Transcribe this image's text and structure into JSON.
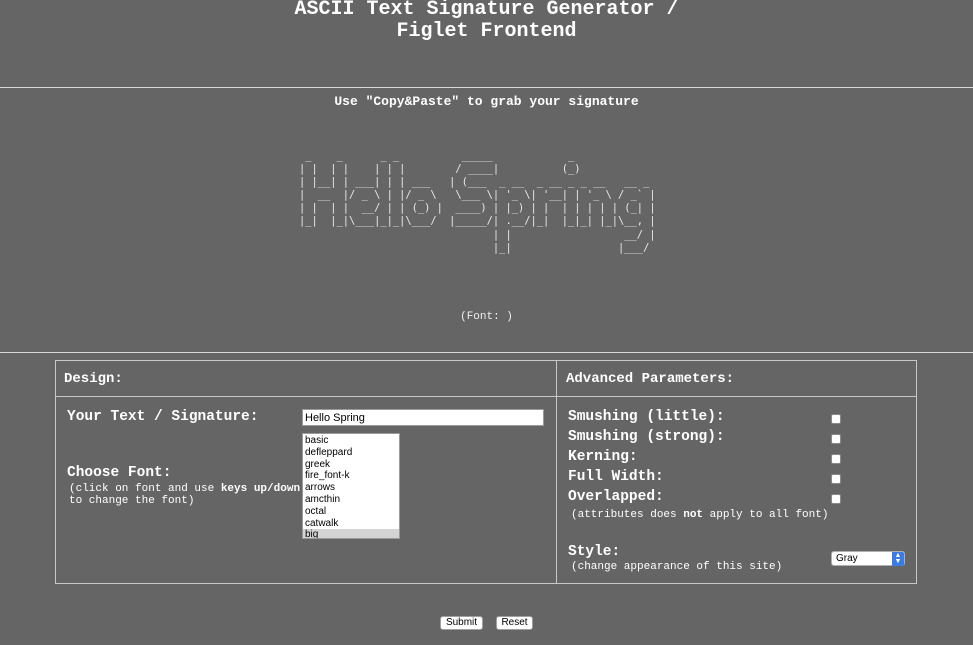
{
  "title_line1": "ASCII Text Signature Generator /",
  "title_line2": "Figlet Frontend",
  "copy_note": "Use \"Copy&Paste\" to grab your signature",
  "ascii_art": " _    _      _ _          _____            _             \n| |  | |    | | |        / ____|          (_)            \n| |__| | ___| | | ___   | (___  _ __  _ __ _ _ __   __ _ \n|  __  |/ _ \\ | |/ _ \\   \\___ \\| '_ \\| '__| | '_ \\ / _` |\n| |  | |  __/ | | (_) |  ____) | |_) | |  | | | | | (_| |\n|_|  |_|\\___|_|_|\\___/  |_____/| .__/|_|  |_|_| |_|\\__, |\n                               | |                  __/ |\n                               |_|                 |___/ ",
  "font_note": "(Font: )",
  "design": {
    "header": "Design:",
    "text_label": "Your Text / Signature:",
    "text_value": "Hello Spring",
    "font_label": "Choose Font:",
    "font_hint_pre": "(click on font and use ",
    "font_hint_bold": "keys up/down",
    "font_hint_post": "to change the font)",
    "fonts": [
      "basic",
      "defleppard",
      "greek",
      "fire_font-k",
      "arrows",
      "amcthin",
      "octal",
      "catwalk",
      "big"
    ],
    "selected_font": "big"
  },
  "advanced": {
    "header": "Advanced Parameters:",
    "options": [
      {
        "label": "Smushing (little):",
        "checked": false
      },
      {
        "label": "Smushing (strong):",
        "checked": false
      },
      {
        "label": "Kerning:",
        "checked": false
      },
      {
        "label": "Full Width:",
        "checked": false
      },
      {
        "label": "Overlapped:",
        "checked": false
      }
    ],
    "note_pre": "(attributes does ",
    "note_bold": "not",
    "note_post": " apply to all font)",
    "style_label": "Style:",
    "style_hint": "(change appearance of this site)",
    "style_value": "Gray"
  },
  "buttons": {
    "submit": "Submit",
    "reset": "Reset"
  },
  "colors": {
    "background": "#656565",
    "select_arrow": "#3b7be5"
  }
}
